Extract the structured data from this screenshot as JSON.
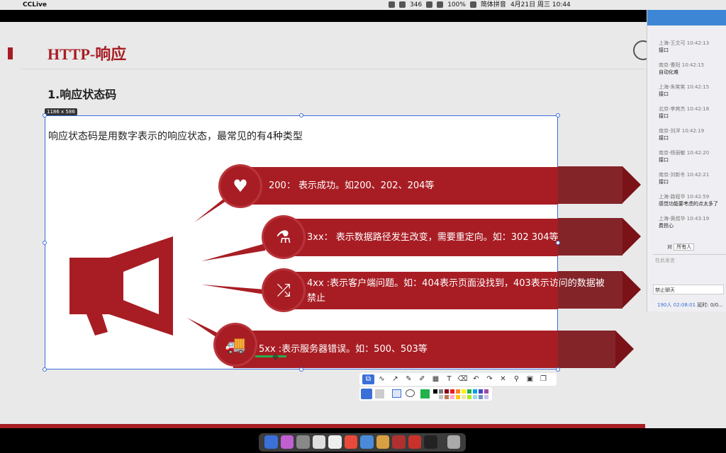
{
  "menubar": {
    "app_name": "CCLive",
    "numbers": "346",
    "battery": "100%",
    "ime": "简体拼音",
    "date": "4月21日 周三 10:44"
  },
  "slide": {
    "title": "HTTP-响应",
    "section_heading": "1.响应状态码"
  },
  "capture": {
    "size_label": "1186 x 586",
    "description": "响应状态码是用数字表示的响应状态，最常见的有4种类型",
    "items": [
      {
        "icon": "heart-icon",
        "text": "200： 表示成功。如200、202、204等"
      },
      {
        "icon": "flask-icon",
        "text": "3xx： 表示数据路径发生改变，需要重定向。如：302 304等"
      },
      {
        "icon": "shuffle-icon",
        "text": "4xx :表示客户端问题。如：404表示页面没找到，403表示访问的数据被禁止"
      },
      {
        "icon": "truck-icon",
        "text": "5xx :表示服务器错误。如：500、503等"
      }
    ]
  },
  "toolbar": {
    "tools": [
      "select-tool",
      "line-tool",
      "arrow-tool",
      "pen-tool",
      "marker-tool",
      "mosaic-tool",
      "text-tool",
      "eraser-tool",
      "undo-tool",
      "redo-tool",
      "close-tool",
      "pin-tool",
      "save-tool",
      "copy-tool"
    ],
    "colors": [
      "#000000",
      "#7f7f7f",
      "#880015",
      "#ed1c24",
      "#ff7f27",
      "#fff200",
      "#22b14c",
      "#00a2e8",
      "#3f48cc",
      "#a349a4",
      "#ffffff",
      "#c3c3c3",
      "#b97a57",
      "#ffaec9",
      "#ffc90e",
      "#efe4b0",
      "#b5e61d",
      "#99d9ea",
      "#7092be",
      "#c8bfe7"
    ],
    "selected_color": "#22b14c"
  },
  "chat": {
    "messages": [
      {
        "who": "上海-王文可 10:42:13",
        "what": "接口"
      },
      {
        "who": "南京-曹阳 10:42:15",
        "what": "自动化难"
      },
      {
        "who": "上海-朱笑笑 10:42:15",
        "what": "接口"
      },
      {
        "who": "北京-李爽杰 10:42:18",
        "what": "接口"
      },
      {
        "who": "南京-刘洋 10:42:19",
        "what": "接口"
      },
      {
        "who": "南京-杨丽敏 10:42:20",
        "what": "接口"
      },
      {
        "who": "南京-刘新冬 10:42:21",
        "what": "接口"
      },
      {
        "who": "上海-路程华 10:42:59",
        "what": "感觉功能要考虑的点太多了"
      },
      {
        "who": "上海-黄煜华 10:43:19",
        "what": "费担心"
      }
    ],
    "to_label": "对",
    "to_value": "所有人",
    "input_placeholder": "在此发言",
    "ban_label": "禁止聊天",
    "online": "190人",
    "time": "02:08:01",
    "delay_label": "延时: 0/0..."
  }
}
